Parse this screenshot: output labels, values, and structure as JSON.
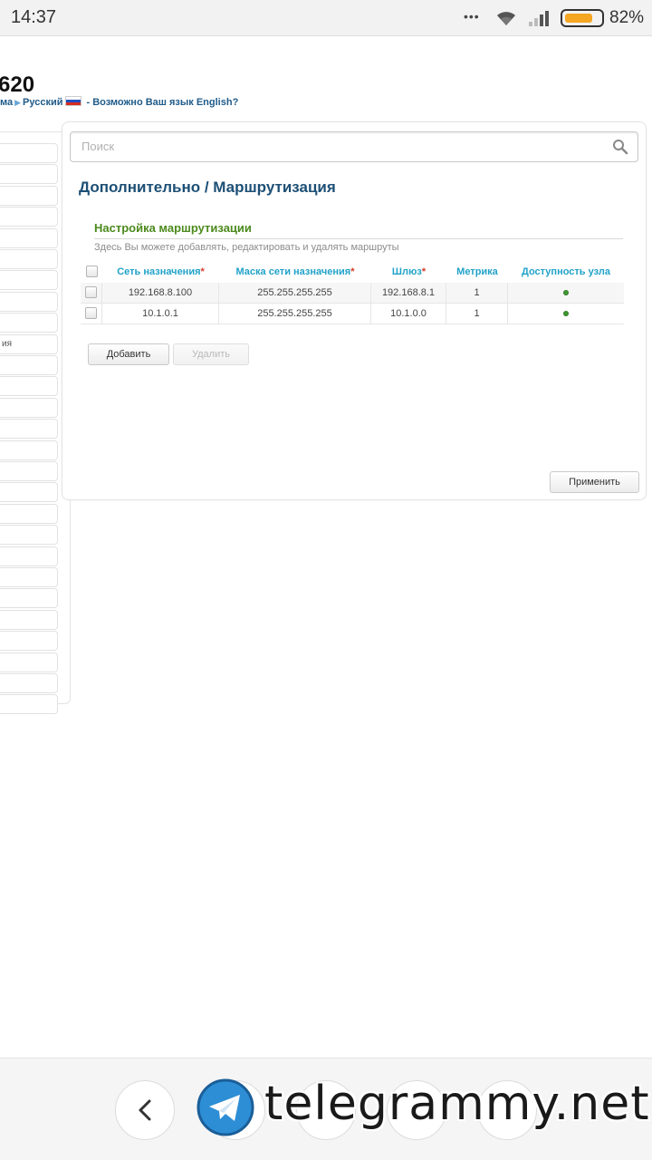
{
  "status_bar": {
    "time": "14:37",
    "dots": "•••",
    "battery_percent": "82%",
    "battery_level": 0.82,
    "battery_color": "#f5a623",
    "icons": [
      "wifi-icon",
      "signal-icon",
      "battery-icon"
    ]
  },
  "header": {
    "title": "620",
    "crumb_system": "ма",
    "crumb_language": "Русский",
    "language_suggestion": "- Возможно Ваш язык English?"
  },
  "sidebar": {
    "partial_label": "ия",
    "item_count": 27
  },
  "search": {
    "placeholder": "Поиск"
  },
  "breadcrumb": {
    "text": "Дополнительно /  Маршрутизация"
  },
  "section": {
    "title": "Настройка маршрутизации",
    "description": "Здесь Вы можете добавлять, редактировать и удалять маршруты"
  },
  "table": {
    "columns": [
      {
        "label": "Сеть назначения",
        "required": "*"
      },
      {
        "label": "Маска сети назначения",
        "required": "*"
      },
      {
        "label": "Шлюз",
        "required": "*"
      },
      {
        "label": "Метрика",
        "required": ""
      },
      {
        "label": "Доступность узла",
        "required": ""
      }
    ],
    "rows": [
      {
        "network": "192.168.8.100",
        "mask": "255.255.255.255",
        "gateway": "192.168.8.1",
        "metric": "1",
        "available": true
      },
      {
        "network": "10.1.0.1",
        "mask": "255.255.255.255",
        "gateway": "10.1.0.0",
        "metric": "1",
        "available": true
      }
    ]
  },
  "buttons": {
    "add": "Добавить",
    "delete": "Удалить",
    "apply": "Применить"
  },
  "colors": {
    "accent_header": "#21a2c9",
    "section_title": "#4c8a1d",
    "breadcrumb": "#1d4f75",
    "required_mark": "#d53b2a",
    "available": "#3f9a2f"
  },
  "watermark": {
    "text": "telegrammy.net",
    "icon": "telegram-logo-icon"
  },
  "navigation": {
    "icons": [
      "back-icon"
    ]
  }
}
